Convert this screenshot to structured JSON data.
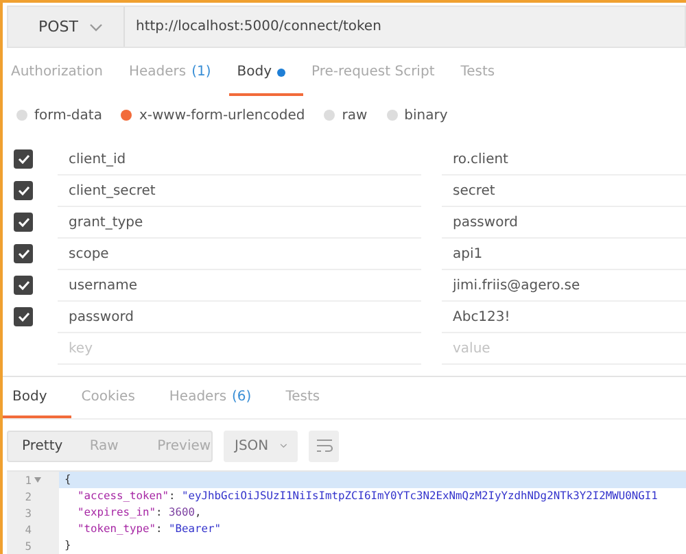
{
  "request": {
    "method": "POST",
    "url": "http://localhost:5000/connect/token"
  },
  "tabs": [
    {
      "label": "Authorization",
      "selected": false
    },
    {
      "label": "Headers",
      "count": "(1)",
      "selected": false
    },
    {
      "label": "Body",
      "dot": true,
      "selected": true
    },
    {
      "label": "Pre-request Script",
      "selected": false
    },
    {
      "label": "Tests",
      "selected": false
    }
  ],
  "body_types": [
    {
      "label": "form-data",
      "selected": false
    },
    {
      "label": "x-www-form-urlencoded",
      "selected": true
    },
    {
      "label": "raw",
      "selected": false
    },
    {
      "label": "binary",
      "selected": false
    }
  ],
  "params": [
    {
      "key": "client_id",
      "value": "ro.client",
      "checked": true
    },
    {
      "key": "client_secret",
      "value": "secret",
      "checked": true
    },
    {
      "key": "grant_type",
      "value": "password",
      "checked": true
    },
    {
      "key": "scope",
      "value": "api1",
      "checked": true
    },
    {
      "key": "username",
      "value": "jimi.friis@agero.se",
      "checked": true
    },
    {
      "key": "password",
      "value": "Abc123!",
      "checked": true
    }
  ],
  "new_param": {
    "key_placeholder": "key",
    "value_placeholder": "value"
  },
  "response_tabs": [
    {
      "label": "Body",
      "selected": true
    },
    {
      "label": "Cookies",
      "selected": false
    },
    {
      "label": "Headers",
      "count": "(6)",
      "selected": false
    },
    {
      "label": "Tests",
      "selected": false
    }
  ],
  "view_modes": [
    {
      "label": "Pretty",
      "selected": true
    },
    {
      "label": "Raw",
      "selected": false
    },
    {
      "label": "Preview",
      "selected": false
    }
  ],
  "format": "JSON",
  "code_lines": [
    {
      "number": "1",
      "fold": true,
      "active": true,
      "tokens": [
        {
          "kind": "punct",
          "text": "{"
        }
      ]
    },
    {
      "number": "2",
      "fold": false,
      "active": false,
      "tokens": [
        {
          "kind": "key",
          "text": "  \"access_token\""
        },
        {
          "kind": "punct",
          "text": ": "
        },
        {
          "kind": "string",
          "text": "\"eyJhbGciOiJSUzI1NiIsImtpZCI6ImY0YTc3N2ExNmQzM2IyYzdhNDg2NTk3Y2I2MWU0NGI1"
        }
      ]
    },
    {
      "number": "3",
      "fold": false,
      "active": false,
      "tokens": [
        {
          "kind": "key",
          "text": "  \"expires_in\""
        },
        {
          "kind": "punct",
          "text": ": "
        },
        {
          "kind": "number",
          "text": "3600"
        },
        {
          "kind": "punct",
          "text": ","
        }
      ]
    },
    {
      "number": "4",
      "fold": false,
      "active": false,
      "tokens": [
        {
          "kind": "key",
          "text": "  \"token_type\""
        },
        {
          "kind": "punct",
          "text": ": "
        },
        {
          "kind": "string",
          "text": "\"Bearer\""
        }
      ]
    },
    {
      "number": "5",
      "fold": false,
      "active": false,
      "tokens": [
        {
          "kind": "punct",
          "text": "}"
        }
      ]
    }
  ]
}
